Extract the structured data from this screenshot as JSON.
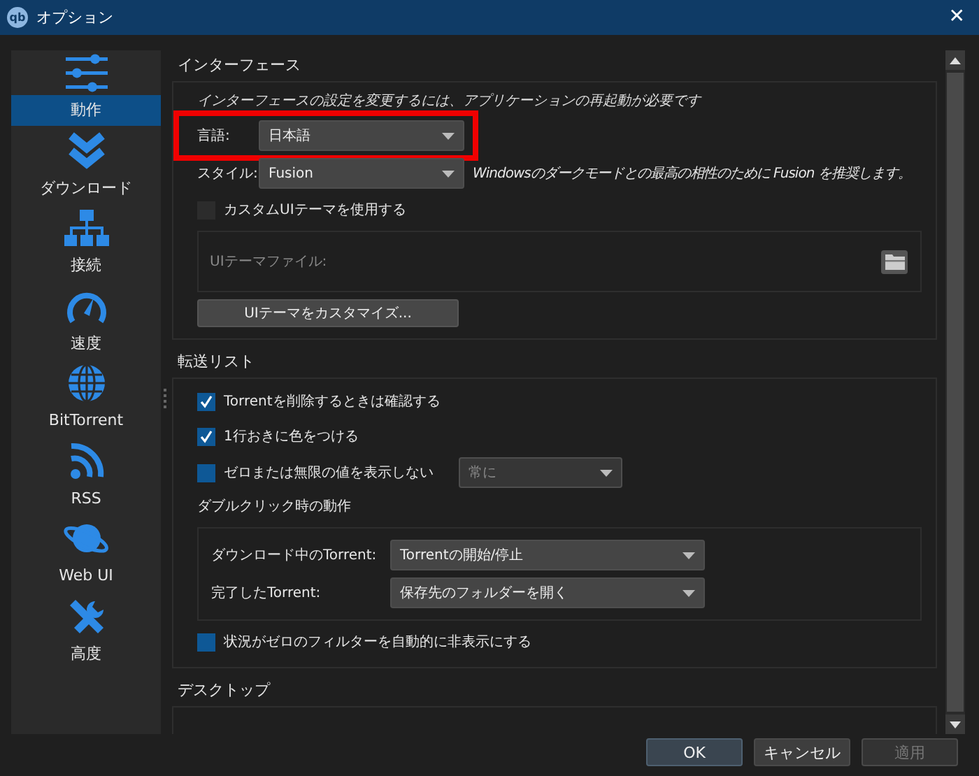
{
  "window": {
    "app_icon": "qb",
    "title": "オプション",
    "close": "✕"
  },
  "sidebar": {
    "items": [
      {
        "label": "動作",
        "kind": "sliders",
        "selected": true
      },
      {
        "label": "ダウンロード",
        "kind": "chevrons",
        "selected": false
      },
      {
        "label": "接続",
        "kind": "network",
        "selected": false
      },
      {
        "label": "速度",
        "kind": "gauge",
        "selected": false
      },
      {
        "label": "BitTorrent",
        "kind": "globe",
        "selected": false
      },
      {
        "label": "RSS",
        "kind": "rss",
        "selected": false
      },
      {
        "label": "Web UI",
        "kind": "planet",
        "selected": false
      },
      {
        "label": "高度",
        "kind": "tools",
        "selected": false
      }
    ]
  },
  "sections": [
    {
      "title": "インターフェース",
      "rows": [
        {
          "kind": "note",
          "label": "インターフェースの設定を変更するには、アプリケーションの再起動が必要です"
        },
        {
          "kind": "combo",
          "label": "言語:",
          "value": "日本語",
          "highlighted": true
        },
        {
          "kind": "combo",
          "label": "スタイル:",
          "value": "Fusion",
          "hint": "Windowsのダークモードとの最高の相性のために Fusion を推奨します。"
        },
        {
          "kind": "checkbox",
          "label": "カスタムUIテーマを使用する",
          "checked": false,
          "accent": false
        },
        {
          "kind": "file",
          "label": "UIテーマファイル:"
        },
        {
          "kind": "button",
          "label": "UIテーマをカスタマイズ..."
        }
      ]
    },
    {
      "title": "転送リスト",
      "rows": [
        {
          "kind": "checkbox",
          "label": "Torrentを削除するときは確認する",
          "checked": true
        },
        {
          "kind": "checkbox",
          "label": "1行おきに色をつける",
          "checked": true
        },
        {
          "kind": "checkbox",
          "label": "ゼロまたは無限の値を表示しない",
          "checked": false,
          "accent": true,
          "combo": {
            "value": "常に",
            "disabled": true
          }
        },
        {
          "kind": "subheading",
          "label": "ダブルクリック時の動作"
        },
        {
          "kind": "group",
          "rows": [
            {
              "kind": "combo",
              "label": "ダウンロード中のTorrent:",
              "value": "Torrentの開始/停止"
            },
            {
              "kind": "combo",
              "label": "完了したTorrent:",
              "value": "保存先のフォルダーを開く"
            }
          ]
        },
        {
          "kind": "checkbox",
          "label": "状況がゼロのフィルターを自動的に非表示にする",
          "checked": false,
          "accent": true
        }
      ]
    },
    {
      "title": "デスクトップ"
    }
  ],
  "buttons": [
    {
      "label": "OK",
      "default": true,
      "disabled": false
    },
    {
      "label": "キャンセル",
      "default": false,
      "disabled": false
    },
    {
      "label": "適用",
      "default": false,
      "disabled": true
    }
  ]
}
